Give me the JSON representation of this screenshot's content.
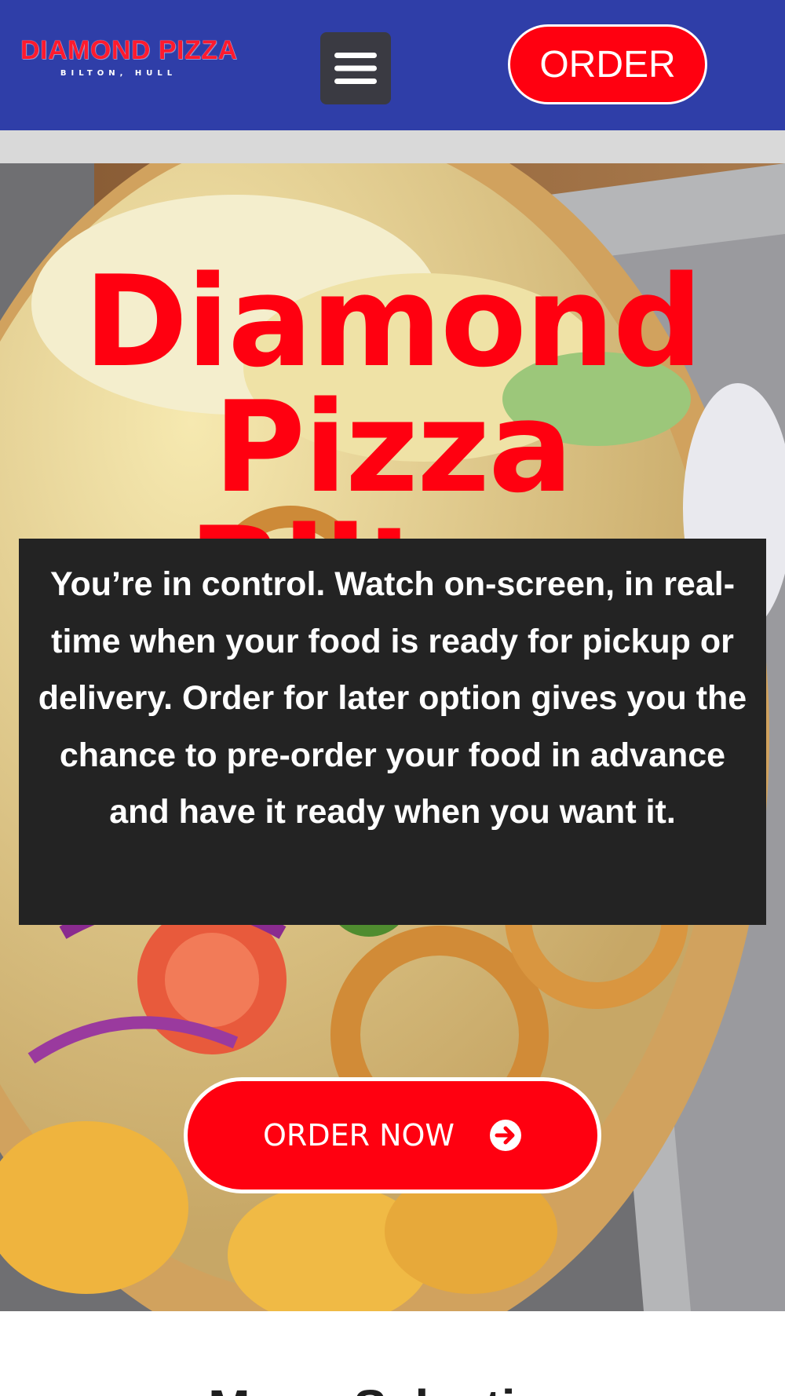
{
  "header": {
    "logo_title": "DIAMOND PIZZA",
    "logo_subtitle": "BILTON, HULL",
    "menu_icon": "hamburger-menu-icon",
    "order_label": "ORDER"
  },
  "hero": {
    "title_line1": "Diamond",
    "title_line2": "Pizza Bilton",
    "description": "You’re in control. Watch on-screen, in real-time when your food is ready for pickup or delivery. Order for later option gives you the chance to pre-order your food in advance and have it ready when you want it.",
    "cta_label": "ORDER NOW",
    "cta_icon": "arrow-circle-right-icon"
  },
  "menu_section": {
    "heading": "Menu Selection"
  },
  "colors": {
    "header_bg": "#2f3ea8",
    "brand_red": "#ff0010",
    "info_box_bg": "#232323",
    "band_gray": "#d9d9d9"
  }
}
